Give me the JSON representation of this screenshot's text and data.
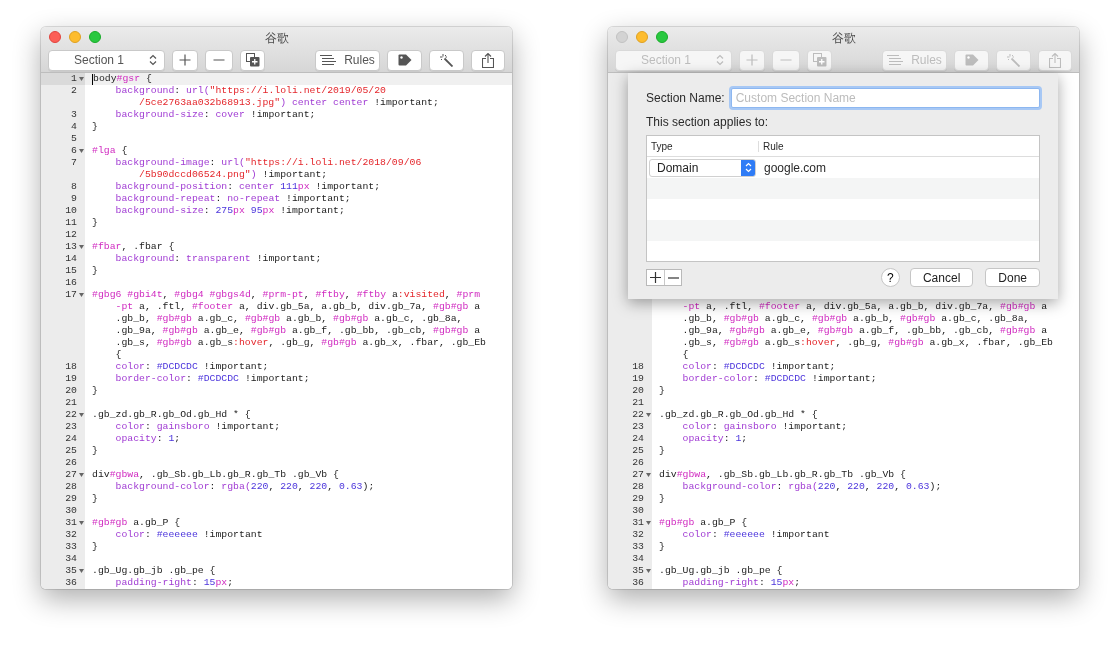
{
  "windows": [
    {
      "title": "谷歌",
      "close_disabled": false,
      "toolbar": {
        "section": "Section 1",
        "rules": "Rules",
        "disabled": false
      },
      "code": [
        {
          "num": "1",
          "fold": true,
          "current": true,
          "kind": "rule",
          "parts": [
            {
              "kind": "p",
              "text": "body"
            },
            {
              "kind": "s",
              "text": "#gsr"
            },
            {
              "kind": "p",
              "text": " {"
            }
          ]
        },
        {
          "num": "2",
          "fold": false,
          "current": false,
          "kind": "decl",
          "parts": [
            {
              "kind": "k",
              "text": "background"
            },
            {
              "kind": "p",
              "text": ": "
            },
            {
              "kind": "k",
              "text": "url("
            },
            {
              "kind": "r",
              "text": "\"https://i.loli.net/2019/05/20"
            }
          ]
        },
        {
          "fold": false,
          "current": false,
          "kind": "wrap",
          "parts": [
            {
              "kind": "r",
              "text": "/5ce2763aa032b68913.jpg\""
            },
            {
              "kind": "k",
              "text": ") center center"
            },
            {
              "kind": "p",
              "text": " !important;"
            }
          ]
        },
        {
          "num": "3",
          "fold": false,
          "current": false,
          "kind": "decl",
          "parts": [
            {
              "kind": "k",
              "text": "background-size"
            },
            {
              "kind": "p",
              "text": ": "
            },
            {
              "kind": "k",
              "text": "cover"
            },
            {
              "kind": "p",
              "text": " !important;"
            }
          ]
        },
        {
          "num": "4",
          "fold": false,
          "current": false,
          "kind": "rule",
          "parts": [
            {
              "kind": "p",
              "text": "}"
            }
          ]
        },
        {
          "num": "5",
          "fold": false,
          "current": false
        },
        {
          "num": "6",
          "fold": true,
          "current": false,
          "kind": "rule",
          "parts": [
            {
              "kind": "s",
              "text": "#lga"
            },
            {
              "kind": "p",
              "text": " {"
            }
          ]
        },
        {
          "num": "7",
          "fold": false,
          "current": false,
          "kind": "decl",
          "parts": [
            {
              "kind": "k",
              "text": "background-image"
            },
            {
              "kind": "p",
              "text": ": "
            },
            {
              "kind": "k",
              "text": "url("
            },
            {
              "kind": "r",
              "text": "\"https://i.loli.net/2018/09/06"
            }
          ]
        },
        {
          "fold": false,
          "current": false,
          "kind": "wrap",
          "parts": [
            {
              "kind": "r",
              "text": "/5b90dccd06524.png\""
            },
            {
              "kind": "k",
              "text": ")"
            },
            {
              "kind": "p",
              "text": " !important;"
            }
          ]
        },
        {
          "num": "8",
          "fold": false,
          "current": false,
          "kind": "decl",
          "parts": [
            {
              "kind": "k",
              "text": "background-position"
            },
            {
              "kind": "p",
              "text": ": "
            },
            {
              "kind": "k",
              "text": "center "
            },
            {
              "kind": "n",
              "text": "111"
            },
            {
              "kind": "s",
              "text": "px"
            },
            {
              "kind": "p",
              "text": " !important;"
            }
          ]
        },
        {
          "num": "9",
          "fold": false,
          "current": false,
          "kind": "decl",
          "parts": [
            {
              "kind": "k",
              "text": "background-repeat"
            },
            {
              "kind": "p",
              "text": ": "
            },
            {
              "kind": "k",
              "text": "no-repeat"
            },
            {
              "kind": "p",
              "text": " !important;"
            }
          ]
        },
        {
          "num": "10",
          "fold": false,
          "current": false,
          "kind": "decl",
          "parts": [
            {
              "kind": "k",
              "text": "background-size"
            },
            {
              "kind": "p",
              "text": ": "
            },
            {
              "kind": "n",
              "text": "275"
            },
            {
              "kind": "s",
              "text": "px "
            },
            {
              "kind": "n",
              "text": "95"
            },
            {
              "kind": "s",
              "text": "px"
            },
            {
              "kind": "p",
              "text": " !important;"
            }
          ]
        },
        {
          "num": "11",
          "fold": false,
          "current": false,
          "kind": "rule",
          "parts": [
            {
              "kind": "p",
              "text": "}"
            }
          ]
        },
        {
          "num": "12",
          "fold": false,
          "current": false
        },
        {
          "num": "13",
          "fold": true,
          "current": false,
          "kind": "rule",
          "parts": [
            {
              "kind": "s",
              "text": "#fbar"
            },
            {
              "kind": "p",
              "text": ", .fbar {"
            }
          ]
        },
        {
          "num": "14",
          "fold": false,
          "current": false,
          "kind": "decl",
          "parts": [
            {
              "kind": "k",
              "text": "background"
            },
            {
              "kind": "p",
              "text": ": "
            },
            {
              "kind": "k",
              "text": "transparent"
            },
            {
              "kind": "p",
              "text": " !important;"
            }
          ]
        },
        {
          "num": "15",
          "fold": false,
          "current": false,
          "kind": "rule",
          "parts": [
            {
              "kind": "p",
              "text": "}"
            }
          ]
        },
        {
          "num": "16",
          "fold": false,
          "current": false
        },
        {
          "num": "17",
          "fold": true,
          "current": false,
          "kind": "rule",
          "parts": [
            {
              "kind": "s",
              "text": "#gbg6 #gbi4t"
            },
            {
              "kind": "p",
              "text": ", "
            },
            {
              "kind": "s",
              "text": "#gbg4 #gbgs4d"
            },
            {
              "kind": "p",
              "text": ", "
            },
            {
              "kind": "s",
              "text": "#prm-pt"
            },
            {
              "kind": "p",
              "text": ", "
            },
            {
              "kind": "s",
              "text": "#ftby"
            },
            {
              "kind": "p",
              "text": ", "
            },
            {
              "kind": "s",
              "text": "#ftby"
            },
            {
              "kind": "p",
              "text": " a"
            },
            {
              "kind": "r",
              "text": ":visited"
            },
            {
              "kind": "p",
              "text": ", "
            },
            {
              "kind": "s",
              "text": "#prm"
            }
          ]
        },
        {
          "fold": false,
          "current": false,
          "kind": "decl",
          "parts": [
            {
              "kind": "s",
              "text": "-pt"
            },
            {
              "kind": "p",
              "text": " a, .ftl, "
            },
            {
              "kind": "s",
              "text": "#footer"
            },
            {
              "kind": "p",
              "text": " a, div.gb_5a, a.gb_b, div.gb_7a, "
            },
            {
              "kind": "s",
              "text": "#gb#gb"
            },
            {
              "kind": "p",
              "text": " a"
            }
          ]
        },
        {
          "fold": false,
          "current": false,
          "kind": "decl",
          "parts": [
            {
              "kind": "p",
              "text": ".gb_b, "
            },
            {
              "kind": "s",
              "text": "#gb#gb"
            },
            {
              "kind": "p",
              "text": " a.gb_c, "
            },
            {
              "kind": "s",
              "text": "#gb#gb"
            },
            {
              "kind": "p",
              "text": " a.gb_b, "
            },
            {
              "kind": "s",
              "text": "#gb#gb"
            },
            {
              "kind": "p",
              "text": " a.gb_c, .gb_8a,"
            }
          ]
        },
        {
          "fold": false,
          "current": false,
          "kind": "decl",
          "parts": [
            {
              "kind": "p",
              "text": ".gb_9a, "
            },
            {
              "kind": "s",
              "text": "#gb#gb"
            },
            {
              "kind": "p",
              "text": " a.gb_e, "
            },
            {
              "kind": "s",
              "text": "#gb#gb"
            },
            {
              "kind": "p",
              "text": " a.gb_f, .gb_bb, .gb_cb, "
            },
            {
              "kind": "s",
              "text": "#gb#gb"
            },
            {
              "kind": "p",
              "text": " a"
            }
          ]
        },
        {
          "fold": false,
          "current": false,
          "kind": "decl",
          "parts": [
            {
              "kind": "p",
              "text": ".gb_s, "
            },
            {
              "kind": "s",
              "text": "#gb#gb"
            },
            {
              "kind": "p",
              "text": " a.gb_s"
            },
            {
              "kind": "r",
              "text": ":hover"
            },
            {
              "kind": "p",
              "text": ", .gb_g, "
            },
            {
              "kind": "s",
              "text": "#gb#gb"
            },
            {
              "kind": "p",
              "text": " a.gb_x, .fbar, .gb_Eb"
            }
          ]
        },
        {
          "fold": false,
          "current": false,
          "kind": "decl",
          "parts": [
            {
              "kind": "p",
              "text": "{"
            }
          ]
        },
        {
          "num": "18",
          "fold": false,
          "current": false,
          "kind": "decl",
          "parts": [
            {
              "kind": "k",
              "text": "color"
            },
            {
              "kind": "p",
              "text": ": "
            },
            {
              "kind": "n",
              "text": "#DCDCDC"
            },
            {
              "kind": "p",
              "text": " !important;"
            }
          ]
        },
        {
          "num": "19",
          "fold": false,
          "current": false,
          "kind": "decl",
          "parts": [
            {
              "kind": "k",
              "text": "border-color"
            },
            {
              "kind": "p",
              "text": ": "
            },
            {
              "kind": "n",
              "text": "#DCDCDC"
            },
            {
              "kind": "p",
              "text": " !important;"
            }
          ]
        },
        {
          "num": "20",
          "fold": false,
          "current": false,
          "kind": "rule",
          "parts": [
            {
              "kind": "p",
              "text": "}"
            }
          ]
        },
        {
          "num": "21",
          "fold": false,
          "current": false
        },
        {
          "num": "22",
          "fold": true,
          "current": false,
          "kind": "rule",
          "parts": [
            {
              "kind": "p",
              "text": ".gb_zd.gb_R.gb_Od.gb_Hd * {"
            }
          ]
        },
        {
          "num": "23",
          "fold": false,
          "current": false,
          "kind": "decl",
          "parts": [
            {
              "kind": "k",
              "text": "color"
            },
            {
              "kind": "p",
              "text": ": "
            },
            {
              "kind": "k",
              "text": "gainsboro"
            },
            {
              "kind": "p",
              "text": " !important;"
            }
          ]
        },
        {
          "num": "24",
          "fold": false,
          "current": false,
          "kind": "decl",
          "parts": [
            {
              "kind": "k",
              "text": "opacity"
            },
            {
              "kind": "p",
              "text": ": "
            },
            {
              "kind": "n",
              "text": "1"
            },
            {
              "kind": "p",
              "text": ";"
            }
          ]
        },
        {
          "num": "25",
          "fold": false,
          "current": false,
          "kind": "rule",
          "parts": [
            {
              "kind": "p",
              "text": "}"
            }
          ]
        },
        {
          "num": "26",
          "fold": false,
          "current": false
        },
        {
          "num": "27",
          "fold": true,
          "current": false,
          "kind": "rule",
          "parts": [
            {
              "kind": "p",
              "text": "div"
            },
            {
              "kind": "s",
              "text": "#gbwa"
            },
            {
              "kind": "p",
              "text": ", .gb_Sb.gb_Lb.gb_R.gb_Tb .gb_Vb {"
            }
          ]
        },
        {
          "num": "28",
          "fold": false,
          "current": false,
          "kind": "decl",
          "parts": [
            {
              "kind": "k",
              "text": "background-color"
            },
            {
              "kind": "p",
              "text": ": "
            },
            {
              "kind": "k",
              "text": "rgba("
            },
            {
              "kind": "n",
              "text": "220"
            },
            {
              "kind": "p",
              "text": ", "
            },
            {
              "kind": "n",
              "text": "220"
            },
            {
              "kind": "p",
              "text": ", "
            },
            {
              "kind": "n",
              "text": "220"
            },
            {
              "kind": "p",
              "text": ", "
            },
            {
              "kind": "n",
              "text": "0.63"
            },
            {
              "kind": "p",
              "text": ");"
            }
          ]
        },
        {
          "num": "29",
          "fold": false,
          "current": false,
          "kind": "rule",
          "parts": [
            {
              "kind": "p",
              "text": "}"
            }
          ]
        },
        {
          "num": "30",
          "fold": false,
          "current": false
        },
        {
          "num": "31",
          "fold": true,
          "current": false,
          "kind": "rule",
          "parts": [
            {
              "kind": "s",
              "text": "#gb#gb"
            },
            {
              "kind": "p",
              "text": " a.gb_P {"
            }
          ]
        },
        {
          "num": "32",
          "fold": false,
          "current": false,
          "kind": "decl",
          "parts": [
            {
              "kind": "k",
              "text": "color"
            },
            {
              "kind": "p",
              "text": ": "
            },
            {
              "kind": "n",
              "text": "#eeeeee"
            },
            {
              "kind": "p",
              "text": " !important"
            }
          ]
        },
        {
          "num": "33",
          "fold": false,
          "current": false,
          "kind": "rule",
          "parts": [
            {
              "kind": "p",
              "text": "}"
            }
          ]
        },
        {
          "num": "34",
          "fold": false,
          "current": false
        },
        {
          "num": "35",
          "fold": true,
          "current": false,
          "kind": "rule",
          "parts": [
            {
              "kind": "p",
              "text": ".gb_Ug.gb_jb .gb_pe {"
            }
          ]
        },
        {
          "num": "36",
          "fold": false,
          "current": false,
          "kind": "decl",
          "parts": [
            {
              "kind": "k",
              "text": "padding-right"
            },
            {
              "kind": "p",
              "text": ": "
            },
            {
              "kind": "n",
              "text": "15"
            },
            {
              "kind": "s",
              "text": "px"
            },
            {
              "kind": "p",
              "text": ";"
            }
          ]
        }
      ]
    },
    {
      "title": "谷歌",
      "close_disabled": true,
      "toolbar": {
        "section": "Section 1",
        "rules": "Rules",
        "disabled": true
      },
      "sheet": {
        "name_label": "Section Name:",
        "name_placeholder": "Custom Section Name",
        "applies_label": "This section applies to:",
        "columns": [
          "Type",
          "Rule"
        ],
        "rows": [
          {
            "type": "Domain",
            "rule": "google.com"
          }
        ],
        "help": "?",
        "cancel": "Cancel",
        "done": "Done"
      },
      "code": [
        {
          "fold": false,
          "current": false,
          "kind": "decl",
          "parts": [
            {
              "kind": "s",
              "text": "-pt"
            },
            {
              "kind": "p",
              "text": " a, .ftl, "
            },
            {
              "kind": "s",
              "text": "#footer"
            },
            {
              "kind": "p",
              "text": " a, div.gb_5a, a.gb_b, div.gb_7a, "
            },
            {
              "kind": "s",
              "text": "#gb#gb"
            },
            {
              "kind": "p",
              "text": " a"
            }
          ]
        },
        {
          "fold": false,
          "current": false,
          "kind": "decl",
          "parts": [
            {
              "kind": "p",
              "text": ".gb_b, "
            },
            {
              "kind": "s",
              "text": "#gb#gb"
            },
            {
              "kind": "p",
              "text": " a.gb_c, "
            },
            {
              "kind": "s",
              "text": "#gb#gb"
            },
            {
              "kind": "p",
              "text": " a.gb_b, "
            },
            {
              "kind": "s",
              "text": "#gb#gb"
            },
            {
              "kind": "p",
              "text": " a.gb_c, .gb_8a,"
            }
          ]
        },
        {
          "fold": false,
          "current": false,
          "kind": "decl",
          "parts": [
            {
              "kind": "p",
              "text": ".gb_9a, "
            },
            {
              "kind": "s",
              "text": "#gb#gb"
            },
            {
              "kind": "p",
              "text": " a.gb_e, "
            },
            {
              "kind": "s",
              "text": "#gb#gb"
            },
            {
              "kind": "p",
              "text": " a.gb_f, .gb_bb, .gb_cb, "
            },
            {
              "kind": "s",
              "text": "#gb#gb"
            },
            {
              "kind": "p",
              "text": " a"
            }
          ]
        },
        {
          "fold": false,
          "current": false,
          "kind": "decl",
          "parts": [
            {
              "kind": "p",
              "text": ".gb_s, "
            },
            {
              "kind": "s",
              "text": "#gb#gb"
            },
            {
              "kind": "p",
              "text": " a.gb_s"
            },
            {
              "kind": "r",
              "text": ":hover"
            },
            {
              "kind": "p",
              "text": ", .gb_g, "
            },
            {
              "kind": "s",
              "text": "#gb#gb"
            },
            {
              "kind": "p",
              "text": " a.gb_x, .fbar, .gb_Eb"
            }
          ]
        },
        {
          "fold": false,
          "current": false,
          "kind": "decl",
          "parts": [
            {
              "kind": "p",
              "text": "{"
            }
          ]
        },
        {
          "num": "18",
          "fold": false,
          "current": false,
          "kind": "decl",
          "parts": [
            {
              "kind": "k",
              "text": "color"
            },
            {
              "kind": "p",
              "text": ": "
            },
            {
              "kind": "n",
              "text": "#DCDCDC"
            },
            {
              "kind": "p",
              "text": " !important;"
            }
          ]
        },
        {
          "num": "19",
          "fold": false,
          "current": false,
          "kind": "decl",
          "parts": [
            {
              "kind": "k",
              "text": "border-color"
            },
            {
              "kind": "p",
              "text": ": "
            },
            {
              "kind": "n",
              "text": "#DCDCDC"
            },
            {
              "kind": "p",
              "text": " !important;"
            }
          ]
        },
        {
          "num": "20",
          "fold": false,
          "current": false,
          "kind": "rule",
          "parts": [
            {
              "kind": "p",
              "text": "}"
            }
          ]
        },
        {
          "num": "21",
          "fold": false,
          "current": false
        },
        {
          "num": "22",
          "fold": true,
          "current": false,
          "kind": "rule",
          "parts": [
            {
              "kind": "p",
              "text": ".gb_zd.gb_R.gb_Od.gb_Hd * {"
            }
          ]
        },
        {
          "num": "23",
          "fold": false,
          "current": false,
          "kind": "decl",
          "parts": [
            {
              "kind": "k",
              "text": "color"
            },
            {
              "kind": "p",
              "text": ": "
            },
            {
              "kind": "k",
              "text": "gainsboro"
            },
            {
              "kind": "p",
              "text": " !important;"
            }
          ]
        },
        {
          "num": "24",
          "fold": false,
          "current": false,
          "kind": "decl",
          "parts": [
            {
              "kind": "k",
              "text": "opacity"
            },
            {
              "kind": "p",
              "text": ": "
            },
            {
              "kind": "n",
              "text": "1"
            },
            {
              "kind": "p",
              "text": ";"
            }
          ]
        },
        {
          "num": "25",
          "fold": false,
          "current": false,
          "kind": "rule",
          "parts": [
            {
              "kind": "p",
              "text": "}"
            }
          ]
        },
        {
          "num": "26",
          "fold": false,
          "current": false
        },
        {
          "num": "27",
          "fold": true,
          "current": false,
          "kind": "rule",
          "parts": [
            {
              "kind": "p",
              "text": "div"
            },
            {
              "kind": "s",
              "text": "#gbwa"
            },
            {
              "kind": "p",
              "text": ", .gb_Sb.gb_Lb.gb_R.gb_Tb .gb_Vb {"
            }
          ]
        },
        {
          "num": "28",
          "fold": false,
          "current": false,
          "kind": "decl",
          "parts": [
            {
              "kind": "k",
              "text": "background-color"
            },
            {
              "kind": "p",
              "text": ": "
            },
            {
              "kind": "k",
              "text": "rgba("
            },
            {
              "kind": "n",
              "text": "220"
            },
            {
              "kind": "p",
              "text": ", "
            },
            {
              "kind": "n",
              "text": "220"
            },
            {
              "kind": "p",
              "text": ", "
            },
            {
              "kind": "n",
              "text": "220"
            },
            {
              "kind": "p",
              "text": ", "
            },
            {
              "kind": "n",
              "text": "0.63"
            },
            {
              "kind": "p",
              "text": ");"
            }
          ]
        },
        {
          "num": "29",
          "fold": false,
          "current": false,
          "kind": "rule",
          "parts": [
            {
              "kind": "p",
              "text": "}"
            }
          ]
        },
        {
          "num": "30",
          "fold": false,
          "current": false
        },
        {
          "num": "31",
          "fold": true,
          "current": false,
          "kind": "rule",
          "parts": [
            {
              "kind": "s",
              "text": "#gb#gb"
            },
            {
              "kind": "p",
              "text": " a.gb_P {"
            }
          ]
        },
        {
          "num": "32",
          "fold": false,
          "current": false,
          "kind": "decl",
          "parts": [
            {
              "kind": "k",
              "text": "color"
            },
            {
              "kind": "p",
              "text": ": "
            },
            {
              "kind": "n",
              "text": "#eeeeee"
            },
            {
              "kind": "p",
              "text": " !important"
            }
          ]
        },
        {
          "num": "33",
          "fold": false,
          "current": false,
          "kind": "rule",
          "parts": [
            {
              "kind": "p",
              "text": "}"
            }
          ]
        },
        {
          "num": "34",
          "fold": false,
          "current": false
        },
        {
          "num": "35",
          "fold": true,
          "current": false,
          "kind": "rule",
          "parts": [
            {
              "kind": "p",
              "text": ".gb_Ug.gb_jb .gb_pe {"
            }
          ]
        },
        {
          "num": "36",
          "fold": false,
          "current": false,
          "kind": "decl",
          "parts": [
            {
              "kind": "k",
              "text": "padding-right"
            },
            {
              "kind": "p",
              "text": ": "
            },
            {
              "kind": "n",
              "text": "15"
            },
            {
              "kind": "s",
              "text": "px"
            },
            {
              "kind": "p",
              "text": ";"
            }
          ]
        }
      ]
    }
  ]
}
